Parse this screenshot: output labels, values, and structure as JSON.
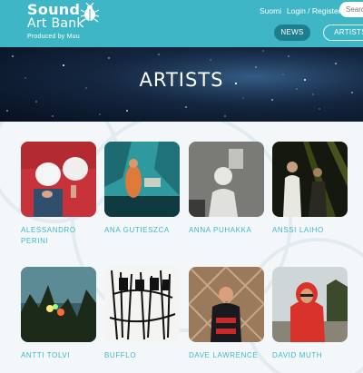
{
  "header": {
    "logo_line1": "Sound",
    "logo_line2": "Art Bank",
    "tagline": "Produced by Muu",
    "language_link": "Suomi",
    "login_link": "Login / Register",
    "search_placeholder": "Search",
    "nav": {
      "news": "NEWS",
      "artists": "ARTISTS"
    }
  },
  "hero": {
    "title": "ARTISTS"
  },
  "artists": [
    {
      "name": "ALESSANDRO PERINI"
    },
    {
      "name": "ANA GUTIESZCA"
    },
    {
      "name": "ANNA PUHAKKA"
    },
    {
      "name": "ANSSI LAIHO"
    },
    {
      "name": "ANTTI TOLVI"
    },
    {
      "name": "BUFFLO"
    },
    {
      "name": "DAVE LAWRENCE"
    },
    {
      "name": "DAVID MUTH"
    }
  ],
  "colors": {
    "accent": "#3fb6c6",
    "nav_active": "#1d7f8e",
    "page_bg": "#f4f7f9"
  }
}
